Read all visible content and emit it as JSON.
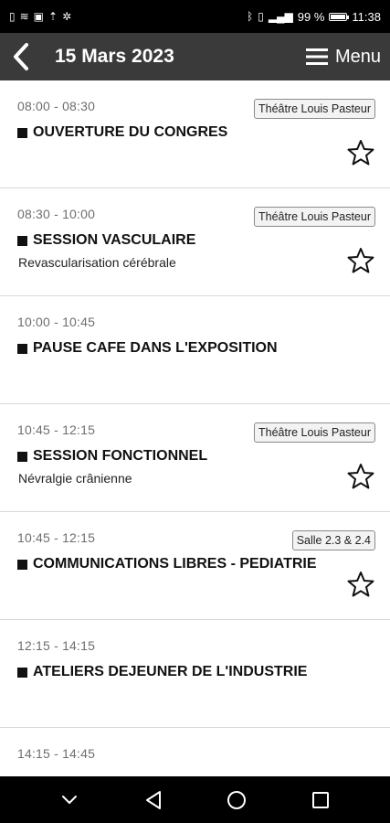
{
  "status_bar": {
    "battery": "99 %",
    "battery_level": 0.99,
    "time": "11:38"
  },
  "header": {
    "title": "15 Mars 2023",
    "menu_label": "Menu"
  },
  "sessions": [
    {
      "time": "08:00 - 08:30",
      "location": "Théâtre Louis Pasteur",
      "title": "OUVERTURE DU CONGRES",
      "subtitle": "",
      "favorite": true
    },
    {
      "time": "08:30 - 10:00",
      "location": "Théâtre Louis Pasteur",
      "title": "SESSION VASCULAIRE",
      "subtitle": "Revascularisation cérébrale",
      "favorite": true
    },
    {
      "time": "10:00 - 10:45",
      "location": "",
      "title": "PAUSE CAFE DANS L'EXPOSITION",
      "subtitle": "",
      "favorite": false
    },
    {
      "time": "10:45 - 12:15",
      "location": "Théâtre Louis Pasteur",
      "title": "SESSION FONCTIONNEL",
      "subtitle": "Névralgie crânienne",
      "favorite": true
    },
    {
      "time": "10:45 - 12:15",
      "location": "Salle 2.3 & 2.4",
      "title": "COMMUNICATIONS LIBRES - PEDIATRIE",
      "subtitle": "",
      "favorite": true
    },
    {
      "time": "12:15 - 14:15",
      "location": "",
      "title": "ATELIERS DEJEUNER DE L'INDUSTRIE",
      "subtitle": "",
      "favorite": false
    },
    {
      "time": "14:15 - 14:45",
      "location": "",
      "title": "",
      "subtitle": "",
      "favorite": false
    }
  ],
  "colors": {
    "status_bar_bg": "#000000",
    "app_bar_bg": "#3a3a3a",
    "nav_bar_bg": "#000000"
  },
  "icons": {
    "back": "chevron-left-icon",
    "menu": "hamburger-icon",
    "favorite": "star-outline-icon",
    "nav_down": "chevron-down-icon",
    "nav_back": "triangle-back-icon",
    "nav_home": "circle-home-icon",
    "nav_recents": "square-recents-icon"
  }
}
